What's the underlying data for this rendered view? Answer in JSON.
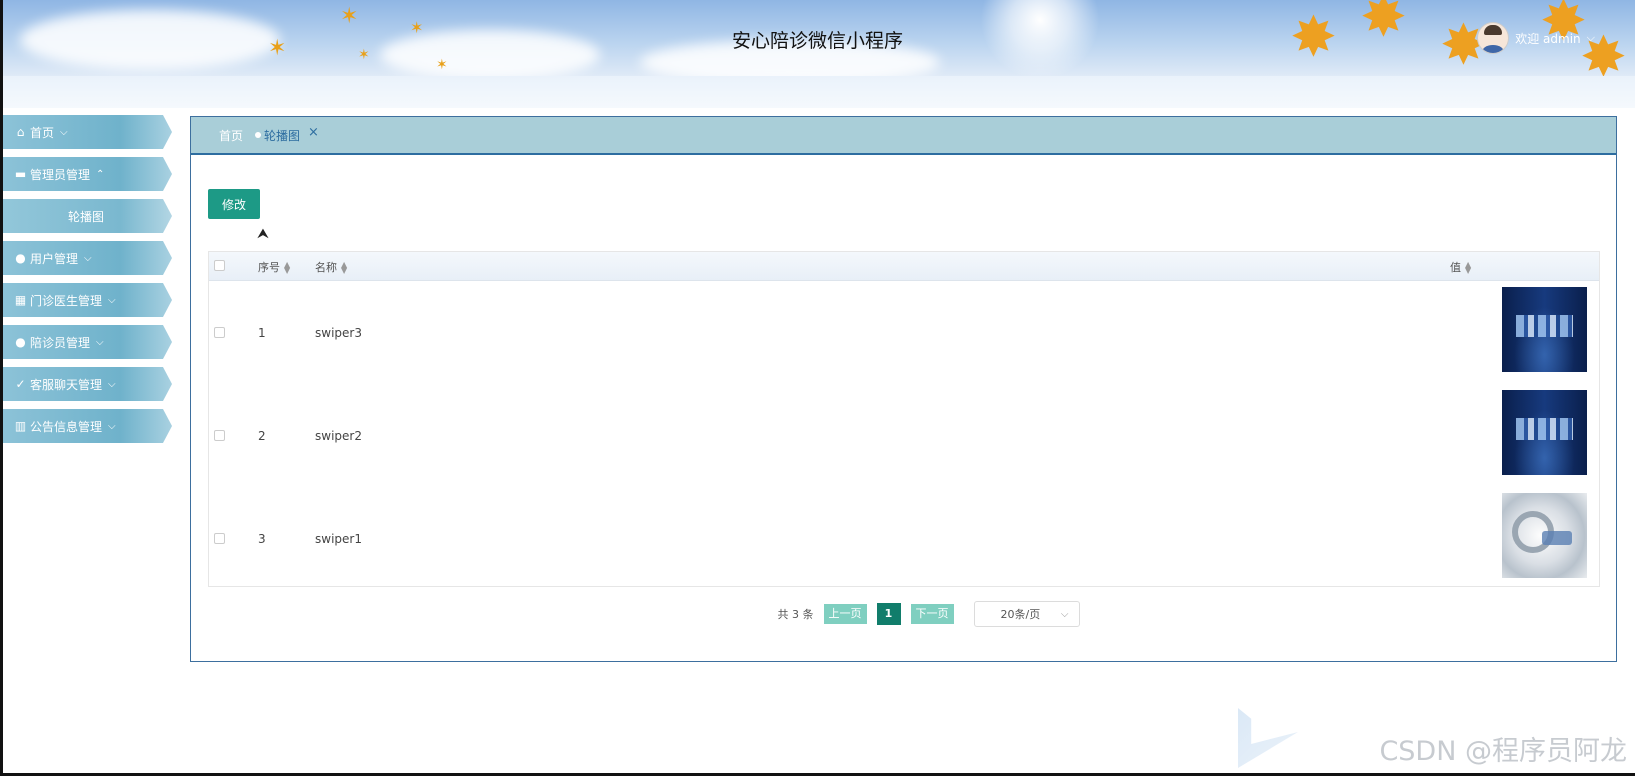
{
  "header": {
    "title": "安心陪诊微信小程序",
    "welcome": "欢迎 admin",
    "user_caret": "⌵"
  },
  "sidebar": {
    "items": [
      {
        "label": "首页",
        "icon": "home-icon",
        "glyph": "⌂",
        "chevron": "⌵",
        "sub": false
      },
      {
        "label": "管理员管理",
        "icon": "briefcase-icon",
        "glyph": "▬",
        "chevron": "⌃",
        "sub": false
      },
      {
        "label": "轮播图",
        "icon": "",
        "glyph": "",
        "chevron": "",
        "sub": true
      },
      {
        "label": "用户管理",
        "icon": "user-icon",
        "glyph": "●",
        "chevron": "⌵",
        "sub": false
      },
      {
        "label": "门诊医生管理",
        "icon": "building-icon",
        "glyph": "▦",
        "chevron": "⌵",
        "sub": false
      },
      {
        "label": "陪诊员管理",
        "icon": "user-icon",
        "glyph": "●",
        "chevron": "⌵",
        "sub": false
      },
      {
        "label": "客服聊天管理",
        "icon": "check-circle-icon",
        "glyph": "✓",
        "chevron": "⌵",
        "sub": false
      },
      {
        "label": "公告信息管理",
        "icon": "chart-icon",
        "glyph": "▥",
        "chevron": "⌵",
        "sub": false
      }
    ]
  },
  "tabs": {
    "home": "首页",
    "active": "轮播图",
    "close": "×"
  },
  "toolbar": {
    "edit_label": "修改"
  },
  "table": {
    "columns": {
      "index": "序号",
      "name": "名称",
      "value": "值"
    },
    "rows": [
      {
        "index": "1",
        "name": "swiper3",
        "thumb": "dark"
      },
      {
        "index": "2",
        "name": "swiper2",
        "thumb": "dark"
      },
      {
        "index": "3",
        "name": "swiper1",
        "thumb": "light"
      }
    ]
  },
  "pagination": {
    "total": "共 3 条",
    "prev": "上一页",
    "current": "1",
    "next": "下一页",
    "page_size": "20条/页"
  },
  "watermark": "CSDN @程序员阿龙",
  "colors": {
    "primary": "#1d9a86",
    "nav": "#6fb2cb",
    "tabbar": "#a9ced8",
    "border": "#3d6f9e"
  }
}
